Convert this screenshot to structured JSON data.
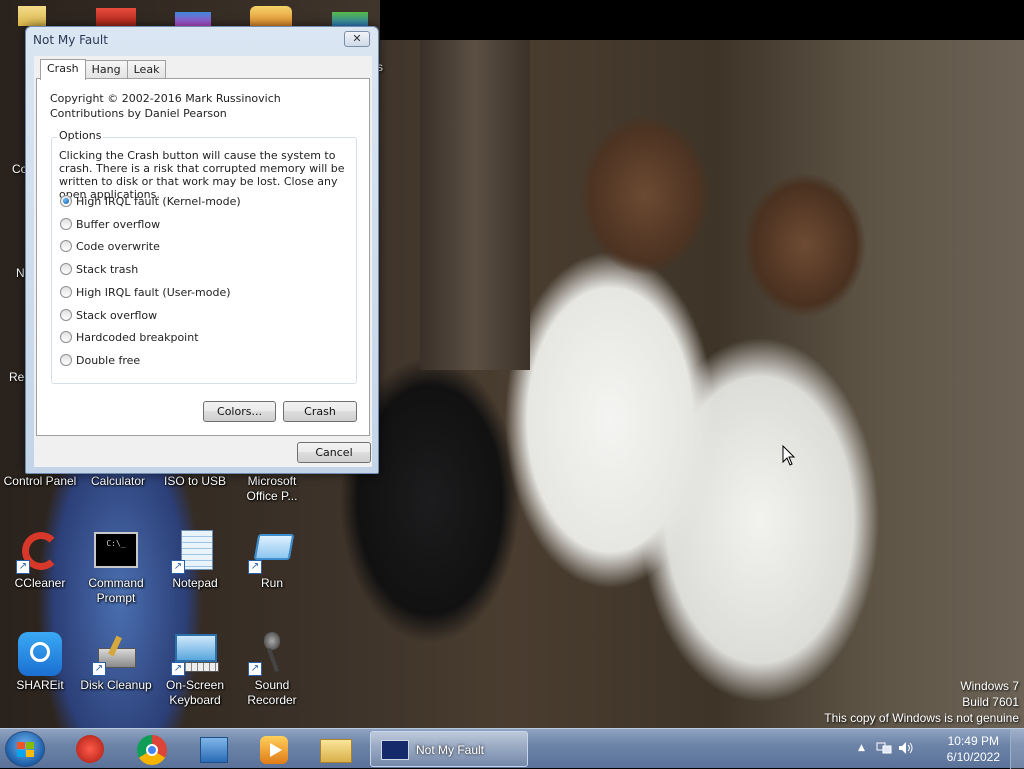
{
  "dialog": {
    "title": "Not My Fault",
    "close_glyph": "✕",
    "tabs": [
      {
        "label": "Crash",
        "active": true
      },
      {
        "label": "Hang",
        "active": false
      },
      {
        "label": "Leak",
        "active": false
      }
    ],
    "copyright_line1": "Copyright © 2002-2016 Mark Russinovich",
    "copyright_line2": "Contributions by Daniel Pearson",
    "options_legend": "Options",
    "warning": "Clicking the Crash button will cause the system to crash. There is a risk that corrupted memory will be written to disk or that work may be lost. Close any open applications.",
    "options": [
      {
        "label": "High IRQL fault (Kernel-mode)",
        "checked": true
      },
      {
        "label": "Buffer overflow",
        "checked": false
      },
      {
        "label": "Code overwrite",
        "checked": false
      },
      {
        "label": "Stack trash",
        "checked": false
      },
      {
        "label": "High IRQL fault (User-mode)",
        "checked": false
      },
      {
        "label": "Stack overflow",
        "checked": false
      },
      {
        "label": "Hardcoded breakpoint",
        "checked": false
      },
      {
        "label": "Double free",
        "checked": false
      }
    ],
    "colors_button": "Colors...",
    "crash_button": "Crash",
    "cancel_button": "Cancel"
  },
  "desktop": {
    "partial_labels": {
      "co": "Co",
      "n": "N",
      "rec": "Rec"
    },
    "partial_title_tail": "s",
    "row1": [
      {
        "label": "Control Panel",
        "icon": "control-panel-icon"
      },
      {
        "label": "Calculator",
        "icon": "calculator-icon"
      },
      {
        "label": "ISO to USB",
        "icon": "iso-to-usb-icon"
      },
      {
        "label": "Microsoft Office P...",
        "icon": "office-icon"
      }
    ],
    "row2": [
      {
        "label": "CCleaner",
        "icon": "ccleaner-icon"
      },
      {
        "label": "Command Prompt",
        "icon": "command-prompt-icon"
      },
      {
        "label": "Notepad",
        "icon": "notepad-icon"
      },
      {
        "label": "Run",
        "icon": "run-icon"
      }
    ],
    "row3": [
      {
        "label": "SHAREit",
        "icon": "shareit-icon"
      },
      {
        "label": "Disk Cleanup",
        "icon": "disk-cleanup-icon"
      },
      {
        "label": "On-Screen Keyboard",
        "icon": "on-screen-keyboard-icon"
      },
      {
        "label": "Sound Recorder",
        "icon": "sound-recorder-icon"
      }
    ]
  },
  "watermark": {
    "line1": "Windows 7",
    "line2": "Build 7601",
    "line3": "This copy of Windows is not genuine"
  },
  "taskbar": {
    "pinned": [
      "media-download-icon",
      "chrome-icon",
      "network-app-icon",
      "media-player-icon",
      "file-explorer-icon"
    ],
    "active_task": "Not My Fault",
    "time": "10:49 PM",
    "date": "6/10/2022",
    "tray_icons": [
      "show-hidden-icons-icon",
      "network-icon",
      "volume-icon"
    ]
  },
  "colors": {
    "taskbar": "#6d84a8",
    "dialog_frame": "#c4d4e8",
    "radio_selected": "#0b4f9c"
  }
}
